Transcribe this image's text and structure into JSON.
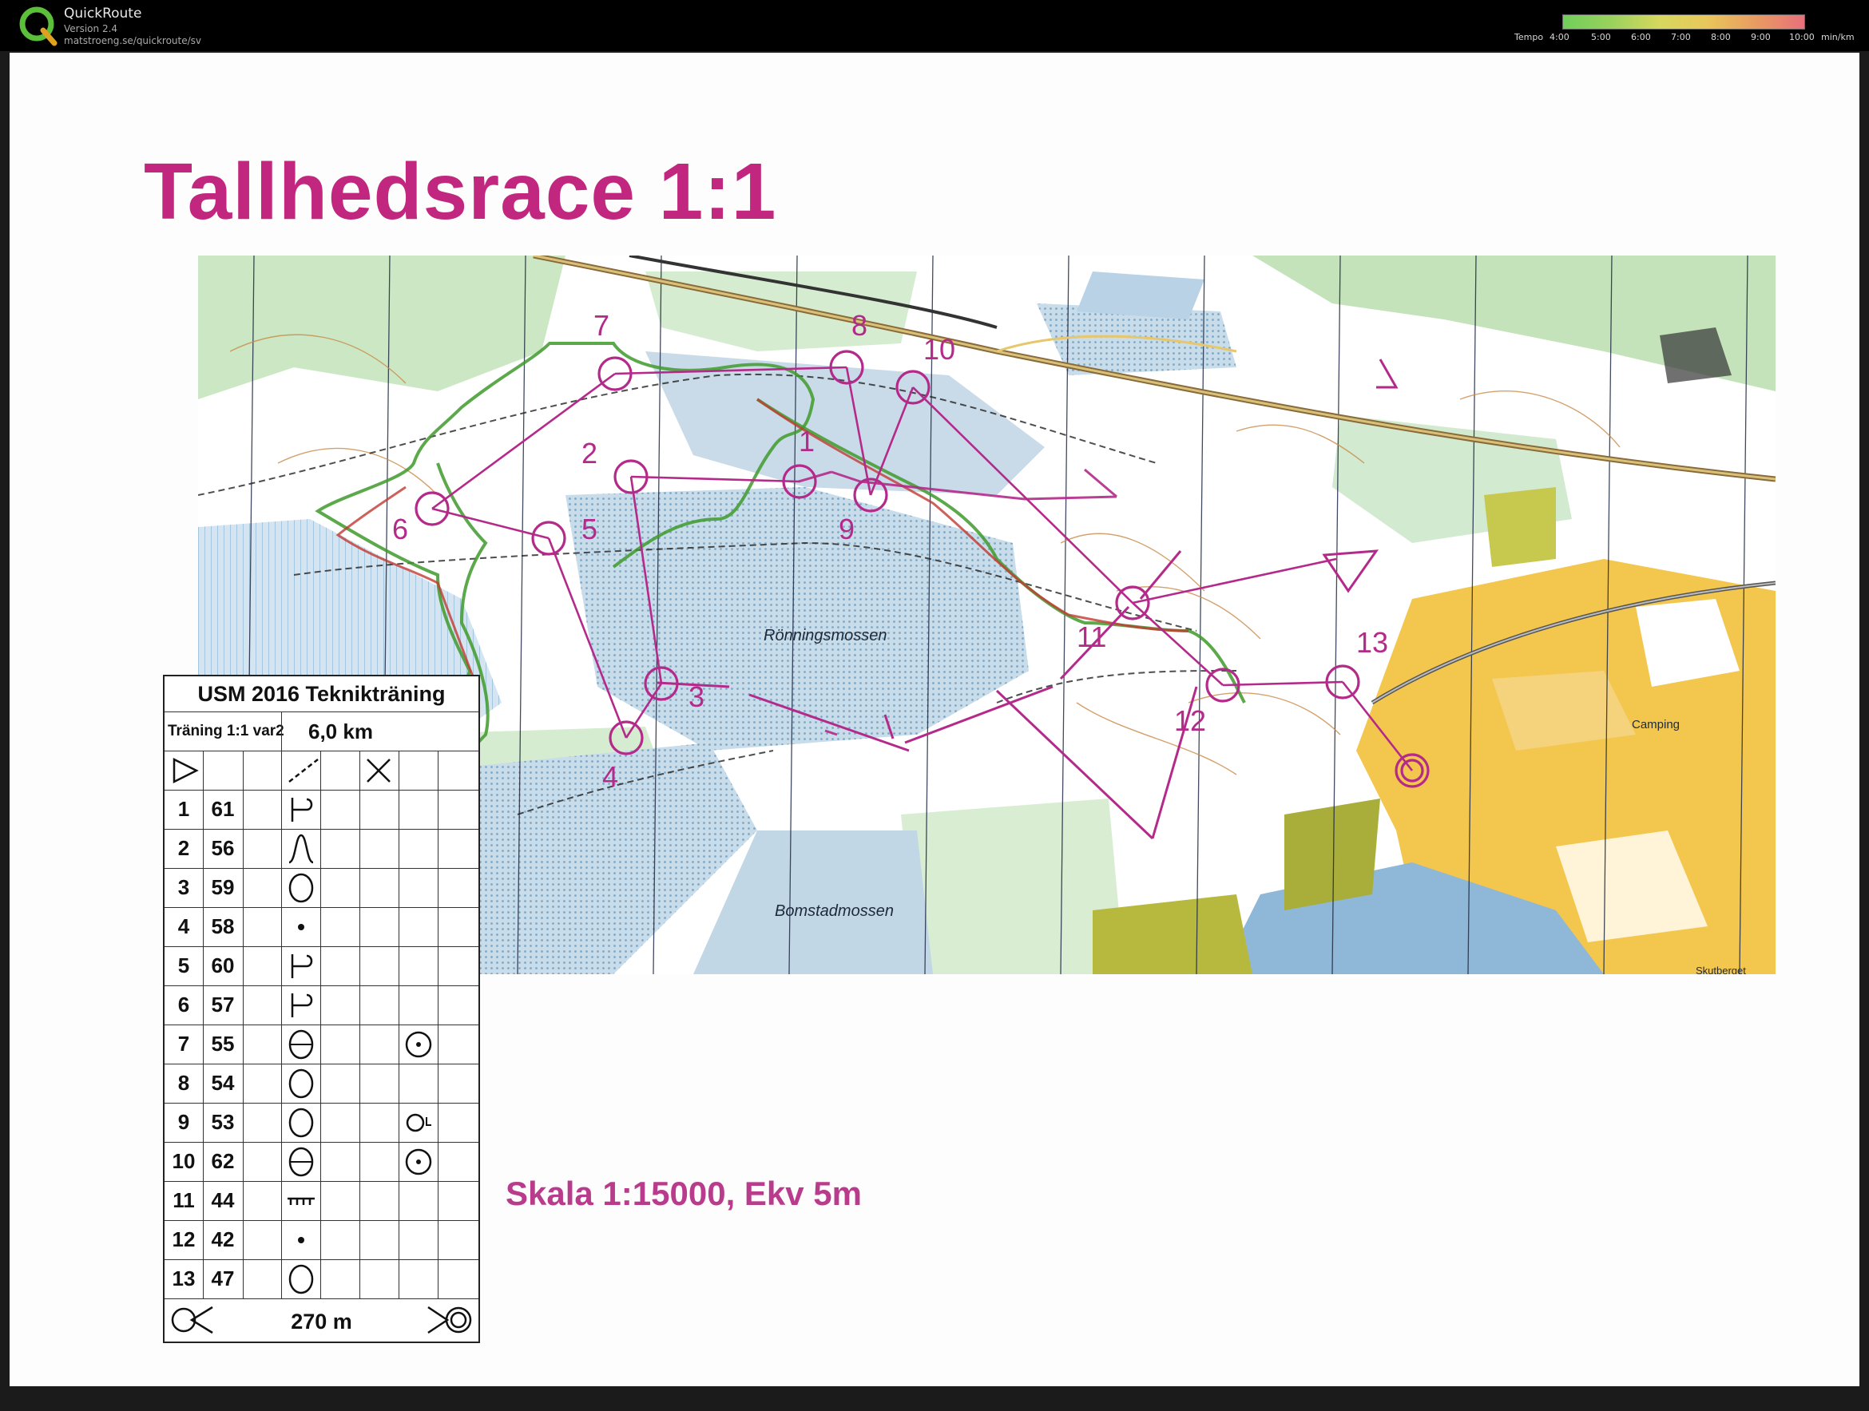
{
  "app": {
    "name": "QuickRoute",
    "version": "Version 2.4",
    "url": "matstroeng.se/quickroute/sv"
  },
  "tempo": {
    "label": "Tempo",
    "ticks": [
      "4:00",
      "5:00",
      "6:00",
      "7:00",
      "8:00",
      "9:00",
      "10:00"
    ],
    "unit": "min/km"
  },
  "map": {
    "title": "Tallhedsrace 1:1",
    "scale_text": "Skala 1:15000, Ekv 5m",
    "place_names": [
      "Rönningsmossen",
      "Bomstadmossen",
      "Camping",
      "Skutberget"
    ],
    "controls": [
      "1",
      "2",
      "3",
      "4",
      "5",
      "6",
      "7",
      "8",
      "9",
      "10",
      "11",
      "12",
      "13"
    ],
    "colors": {
      "course": "#b42a8a",
      "route_green": "#3f9a2c",
      "route_red": "#c23a32",
      "title": "#c2277f"
    }
  },
  "control_card": {
    "event": "USM 2016 Teknikträning",
    "course": "Träning 1:1 var2",
    "length": "6,0 km",
    "rows": [
      {
        "num": "1",
        "code": "61"
      },
      {
        "num": "2",
        "code": "56"
      },
      {
        "num": "3",
        "code": "59"
      },
      {
        "num": "4",
        "code": "58"
      },
      {
        "num": "5",
        "code": "60"
      },
      {
        "num": "6",
        "code": "57"
      },
      {
        "num": "7",
        "code": "55"
      },
      {
        "num": "8",
        "code": "54"
      },
      {
        "num": "9",
        "code": "53"
      },
      {
        "num": "10",
        "code": "62"
      },
      {
        "num": "11",
        "code": "44"
      },
      {
        "num": "12",
        "code": "42"
      },
      {
        "num": "13",
        "code": "47"
      }
    ],
    "finish_distance": "270 m"
  }
}
